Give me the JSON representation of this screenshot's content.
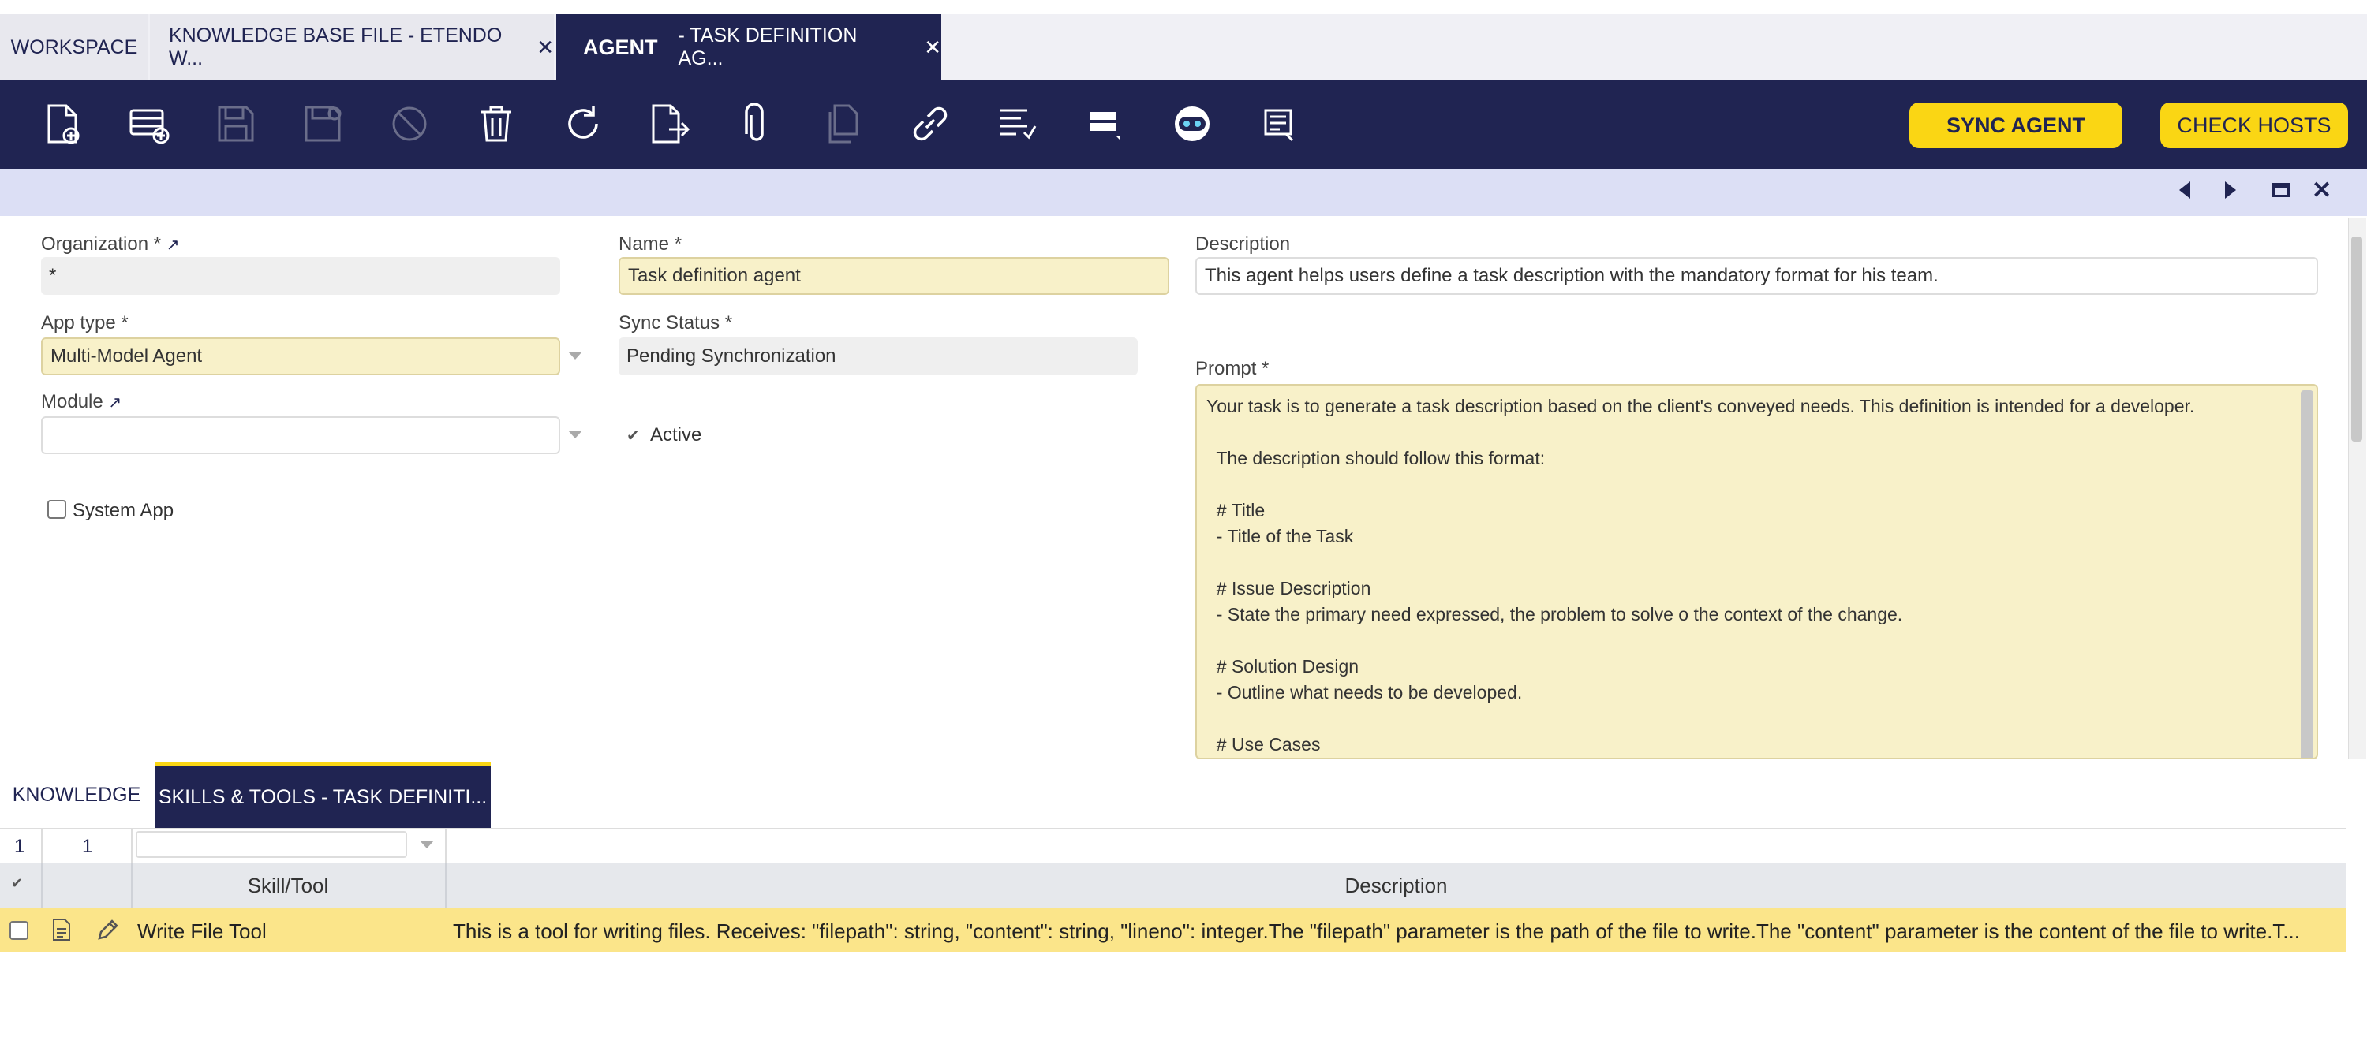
{
  "tabs": [
    {
      "label": "WORKSPACE"
    },
    {
      "label": "KNOWLEDGE BASE FILE - ETENDO W..."
    },
    {
      "label": "AGENT",
      "sublabel": "- TASK DEFINITION AG..."
    }
  ],
  "toolbar": {
    "icons": [
      "new-document-icon",
      "new-row-icon",
      "save-icon",
      "save-close-icon",
      "cancel-icon",
      "delete-icon",
      "refresh-icon",
      "export-icon",
      "attachment-icon",
      "copy-icon",
      "link-icon",
      "audit-icon",
      "grid-view-icon",
      "copilot-icon",
      "notes-icon"
    ],
    "sync_agent": "SYNC AGENT",
    "check_hosts": "CHECK HOSTS"
  },
  "form": {
    "organization_label": "Organization *",
    "organization_value": "*",
    "name_label": "Name *",
    "name_value": "Task definition agent",
    "description_label": "Description",
    "description_value": "This agent helps users define a task description with the mandatory format for his team.",
    "apptype_label": "App type *",
    "apptype_value": "Multi-Model Agent",
    "sync_label": "Sync Status *",
    "sync_value": "Pending Synchronization",
    "module_label": "Module",
    "module_value": "",
    "active_label": "Active",
    "system_app_label": "System App",
    "prompt_label": "Prompt *",
    "prompt_lines": [
      "Your task is to generate a task description based on the client's conveyed needs. This definition is intended for a developer.",
      "",
      "  The description should follow this format:",
      "",
      "  # Title",
      "  - Title of the Task",
      "",
      "  # Issue Description",
      "  - State the primary need expressed, the problem to solve o the context of the change.",
      "",
      "  # Solution Design",
      "  - Outline what needs to be developed.",
      "",
      "  # Use Cases"
    ]
  },
  "bottom_tabs": [
    {
      "label": "KNOWLEDGE"
    },
    {
      "label": "SKILLS & TOOLS - TASK DEFINITI..."
    }
  ],
  "grid": {
    "count_left": "1",
    "count_right": "1",
    "col_skill": "Skill/Tool",
    "col_desc": "Description",
    "rows": [
      {
        "skill": "Write File Tool",
        "desc": "This is a tool for writing files. Receives: \"filepath\": string, \"content\": string, \"lineno\": integer.The \"filepath\" parameter is the path of the file to write.The \"content\" parameter is the content of the file to write.T..."
      }
    ]
  }
}
